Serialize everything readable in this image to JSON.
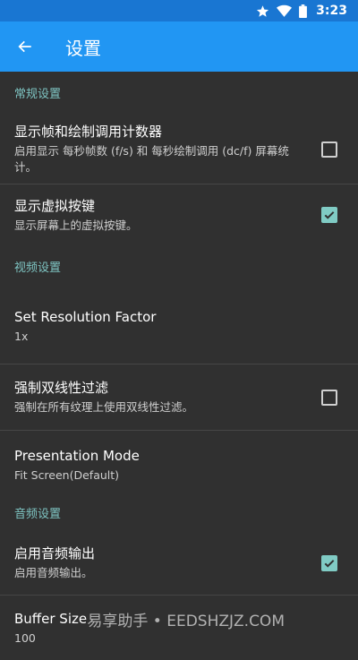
{
  "status_bar": {
    "time": "3:23",
    "icons": [
      "star-icon",
      "wifi-icon",
      "battery-icon"
    ]
  },
  "app_bar": {
    "title": "设置",
    "back_icon": "arrow-back-icon"
  },
  "sections": {
    "general": "常规设置",
    "video": "视频设置",
    "audio": "音频设置"
  },
  "prefs": {
    "show_fps": {
      "title": "显示帧和绘制调用计数器",
      "summary": "启用显示 每秒帧数 (f/s) 和 每秒绘制调用 (dc/f) 屏幕统计。",
      "checked": false
    },
    "virtual_keys": {
      "title": "显示虚拟按键",
      "summary": "显示屏幕上的虚拟按键。",
      "checked": true
    },
    "resolution": {
      "title": "Set Resolution Factor",
      "summary": "1x"
    },
    "bilinear": {
      "title": "强制双线性过滤",
      "summary": "强制在所有纹理上使用双线性过滤。",
      "checked": false
    },
    "presentation": {
      "title": "Presentation Mode",
      "summary": "Fit Screen(Default)"
    },
    "audio_output": {
      "title": "启用音频输出",
      "summary": "启用音频输出。",
      "checked": true
    },
    "buffer": {
      "title": "Buffer Size",
      "summary": "100"
    }
  },
  "watermark": "易享助手 • EEDSHZJZ.COM",
  "colors": {
    "status_bar": "#1976d2",
    "app_bar": "#2196f3",
    "background": "#303030",
    "accent": "#80cbc4",
    "section_text": "#7ec4c2"
  }
}
